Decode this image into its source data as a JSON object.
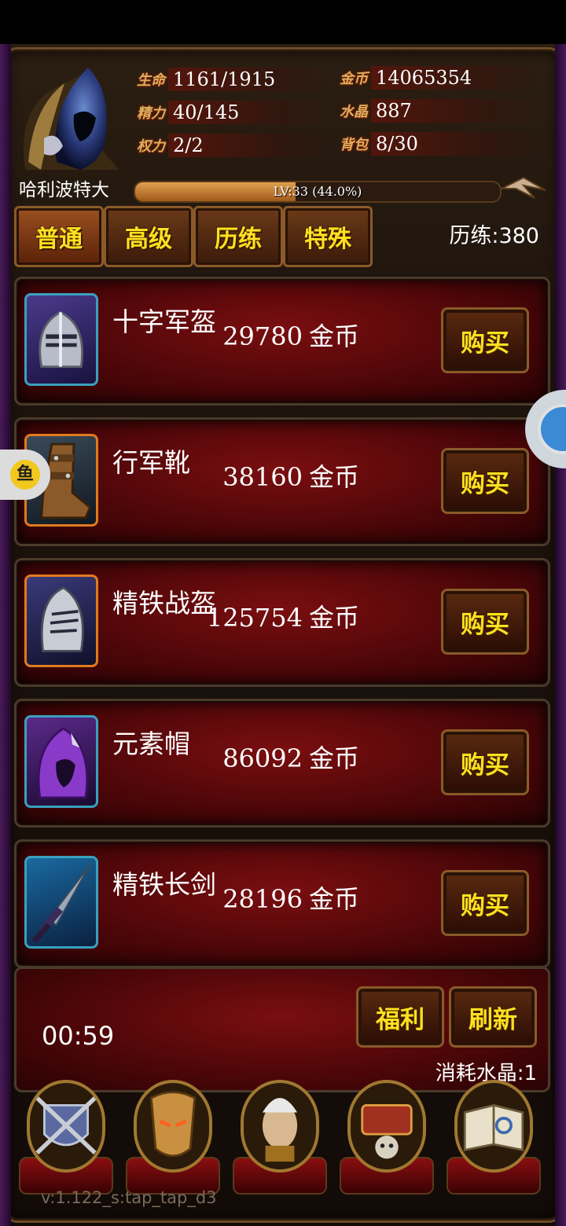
{
  "header": {
    "stats_left": [
      {
        "label": "生命",
        "value": "1161/1915"
      },
      {
        "label": "精力",
        "value": "40/145"
      },
      {
        "label": "权力",
        "value": "2/2"
      }
    ],
    "stats_right": [
      {
        "label": "金币",
        "value": "14065354"
      },
      {
        "label": "水晶",
        "value": "887"
      },
      {
        "label": "背包",
        "value": "8/30"
      }
    ],
    "player_name": "哈利波特大",
    "level_text": "LV:33 (44.0%)",
    "level_progress": 0.44
  },
  "tabs": [
    {
      "label": "普通",
      "active": true
    },
    {
      "label": "高级",
      "active": false
    },
    {
      "label": "历练",
      "active": false
    },
    {
      "label": "特殊",
      "active": false
    }
  ],
  "experience_text": "历练:380",
  "items": [
    {
      "name": "十字军盔",
      "price": "29780",
      "unit": "金币",
      "buy_label": "购买",
      "icon": "crusader-helmet-icon",
      "border": "#3aa0c0"
    },
    {
      "name": "行军靴",
      "price": "38160",
      "unit": "金币",
      "buy_label": "购买",
      "icon": "march-boots-icon",
      "border": "#e07a20"
    },
    {
      "name": "精铁战盔",
      "price": "125754",
      "unit": "金币",
      "buy_label": "购买",
      "icon": "iron-war-helmet-icon",
      "border": "#e07a20"
    },
    {
      "name": "元素帽",
      "price": "86092",
      "unit": "金币",
      "buy_label": "购买",
      "icon": "elemental-hood-icon",
      "border": "#3aa0c0"
    },
    {
      "name": "精铁长剑",
      "price": "28196",
      "unit": "金币",
      "buy_label": "购买",
      "icon": "iron-longsword-icon",
      "border": "#3aa0c0"
    }
  ],
  "footer": {
    "timer": "00:59",
    "welfare_label": "福利",
    "refresh_label": "刷新",
    "cost_text": "消耗水晶:1"
  },
  "nav": [
    {
      "icon": "guild-crest-icon"
    },
    {
      "icon": "hero-mask-icon"
    },
    {
      "icon": "mage-portrait-icon"
    },
    {
      "icon": "treasure-chest-icon"
    },
    {
      "icon": "spellbook-icon"
    }
  ],
  "version": "v:1.122_s:tap_tap_d3",
  "floating_left_glyph": "鱼"
}
